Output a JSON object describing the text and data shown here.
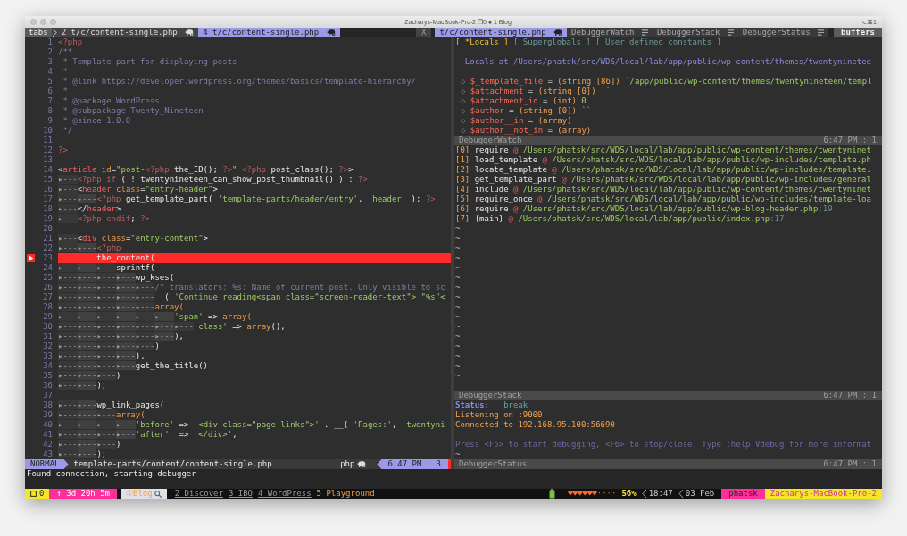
{
  "window": {
    "title": "Zacharys-MacBook-Pro-2 ❐0 ● 1 Blog",
    "shortcut": "⌥⌘1"
  },
  "tabline": {
    "label": "tabs",
    "buffers": [
      {
        "label": "2 t/c/content-single.php",
        "selected": false
      },
      {
        "label": "4 t/c/content-single.php",
        "selected": true
      }
    ],
    "close": "X",
    "windows": [
      {
        "label": "t/c/content-single.php",
        "selected": true,
        "kind": "file"
      },
      {
        "label": "DebuggerWatch",
        "selected": false,
        "kind": "debugger"
      },
      {
        "label": "DebuggerStack",
        "selected": false,
        "kind": "debugger"
      },
      {
        "label": "DebuggerStatus",
        "selected": false,
        "kind": "debugger"
      }
    ],
    "right_label": "buffers"
  },
  "editor": {
    "lines": [
      {
        "number": "1",
        "breakpoint": false,
        "tokens": [
          {
            "text": "<?php",
            "kind": "php"
          }
        ]
      },
      {
        "number": "2",
        "breakpoint": false,
        "tokens": [
          {
            "text": "/**",
            "kind": "cm"
          }
        ]
      },
      {
        "number": "3",
        "breakpoint": false,
        "tokens": [
          {
            "text": " * Template part for displaying posts",
            "kind": "cm"
          }
        ]
      },
      {
        "number": "4",
        "breakpoint": false,
        "tokens": [
          {
            "text": " *",
            "kind": "cm"
          }
        ]
      },
      {
        "number": "5",
        "breakpoint": false,
        "tokens": [
          {
            "text": " * @link https://developer.wordpress.org/themes/basics/template-hierarchy/",
            "kind": "cm"
          }
        ]
      },
      {
        "number": "6",
        "breakpoint": false,
        "tokens": [
          {
            "text": " *",
            "kind": "cm"
          }
        ]
      },
      {
        "number": "7",
        "breakpoint": false,
        "tokens": [
          {
            "text": " * @package WordPress",
            "kind": "cm"
          }
        ]
      },
      {
        "number": "8",
        "breakpoint": false,
        "tokens": [
          {
            "text": " * @subpackage Twenty_Nineteen",
            "kind": "cm"
          }
        ]
      },
      {
        "number": "9",
        "breakpoint": false,
        "tokens": [
          {
            "text": " * @since 1.0.0",
            "kind": "cm"
          }
        ]
      },
      {
        "number": "10",
        "breakpoint": false,
        "tokens": [
          {
            "text": " */",
            "kind": "cm"
          }
        ]
      },
      {
        "number": "11",
        "breakpoint": false
      },
      {
        "number": "12",
        "breakpoint": false,
        "tokens": [
          {
            "text": "?>",
            "kind": "php"
          }
        ]
      },
      {
        "number": "13",
        "breakpoint": false
      },
      {
        "number": "14",
        "breakpoint": false,
        "tokens": [
          {
            "text": "<",
            "kind": "pl"
          },
          {
            "text": "article",
            "kind": "tag"
          },
          {
            "text": " id",
            "kind": "kw"
          },
          {
            "text": "=",
            "kind": "pl"
          },
          {
            "text": "\"post-",
            "kind": "str"
          },
          {
            "text": "<?php",
            "kind": "php"
          },
          {
            "text": " the_ID(); ",
            "kind": "pl"
          },
          {
            "text": "?>",
            "kind": "php"
          },
          {
            "text": "\"",
            "kind": "str"
          },
          {
            "text": " <?php",
            "kind": "php"
          },
          {
            "text": " post_class(); ",
            "kind": "pl"
          },
          {
            "text": "?>",
            "kind": "php"
          },
          {
            "text": ">",
            "kind": "pl"
          }
        ]
      },
      {
        "number": "15",
        "breakpoint": false,
        "tokens": [
          {
            "text": "▸---",
            "kind": "tab"
          },
          {
            "text": "<?php if",
            "kind": "php"
          },
          {
            "text": " ( ! twentynineteen_can_show_post_thumbnail() ) : ",
            "kind": "pl"
          },
          {
            "text": "?>",
            "kind": "php"
          }
        ]
      },
      {
        "number": "16",
        "breakpoint": false,
        "tokens": [
          {
            "text": "▸---",
            "kind": "tab"
          },
          {
            "text": "<",
            "kind": "pl"
          },
          {
            "text": "header",
            "kind": "tag"
          },
          {
            "text": " class",
            "kind": "kw"
          },
          {
            "text": "=",
            "kind": "pl"
          },
          {
            "text": "\"entry-header\"",
            "kind": "str"
          },
          {
            "text": ">",
            "kind": "pl"
          }
        ]
      },
      {
        "number": "17",
        "breakpoint": false,
        "tokens": [
          {
            "text": "▸---",
            "kind": "tab"
          },
          {
            "text": "▸---",
            "kind": "tab"
          },
          {
            "text": "<?php",
            "kind": "php"
          },
          {
            "text": " get_template_part( ",
            "kind": "pl"
          },
          {
            "text": "'template-parts/header/entry'",
            "kind": "str"
          },
          {
            "text": ", ",
            "kind": "pl"
          },
          {
            "text": "'header'",
            "kind": "str"
          },
          {
            "text": " ); ",
            "kind": "pl"
          },
          {
            "text": "?>",
            "kind": "php"
          }
        ]
      },
      {
        "number": "18",
        "breakpoint": false,
        "tokens": [
          {
            "text": "▸---",
            "kind": "tab"
          },
          {
            "text": "</",
            "kind": "pl"
          },
          {
            "text": "header",
            "kind": "tag"
          },
          {
            "text": ">",
            "kind": "pl"
          }
        ]
      },
      {
        "number": "19",
        "breakpoint": false,
        "tokens": [
          {
            "text": "▸---",
            "kind": "tab"
          },
          {
            "text": "<?php endif",
            "kind": "php"
          },
          {
            "text": "; ",
            "kind": "pl"
          },
          {
            "text": "?>",
            "kind": "php"
          }
        ]
      },
      {
        "number": "20",
        "breakpoint": false
      },
      {
        "number": "21",
        "breakpoint": false,
        "tokens": [
          {
            "text": "▸---",
            "kind": "tab"
          },
          {
            "text": "<",
            "kind": "pl"
          },
          {
            "text": "div",
            "kind": "tag"
          },
          {
            "text": " class",
            "kind": "kw"
          },
          {
            "text": "=",
            "kind": "pl"
          },
          {
            "text": "\"entry-content\"",
            "kind": "str"
          },
          {
            "text": ">",
            "kind": "pl"
          }
        ]
      },
      {
        "number": "22",
        "breakpoint": false,
        "tokens": [
          {
            "text": "▸---",
            "kind": "tab"
          },
          {
            "text": "▸---",
            "kind": "tab"
          },
          {
            "text": "<?php",
            "kind": "php"
          }
        ]
      },
      {
        "number": "23",
        "breakpoint": true,
        "tokens": [
          {
            "text": "        the_content(",
            "kind": "pl"
          }
        ]
      },
      {
        "number": "24",
        "breakpoint": false,
        "tokens": [
          {
            "text": "▸---",
            "kind": "tab"
          },
          {
            "text": "▸---",
            "kind": "tab"
          },
          {
            "text": "▸---",
            "kind": "tab"
          },
          {
            "text": "sprintf(",
            "kind": "pl"
          }
        ]
      },
      {
        "number": "25",
        "breakpoint": false,
        "tokens": [
          {
            "text": "▸---",
            "kind": "tab"
          },
          {
            "text": "▸---",
            "kind": "tab"
          },
          {
            "text": "▸---",
            "kind": "tab"
          },
          {
            "text": "▸---",
            "kind": "tab"
          },
          {
            "text": "wp_kses(",
            "kind": "pl"
          }
        ]
      },
      {
        "number": "26",
        "breakpoint": false,
        "tokens": [
          {
            "text": "▸---",
            "kind": "tab"
          },
          {
            "text": "▸---",
            "kind": "tab"
          },
          {
            "text": "▸---",
            "kind": "tab"
          },
          {
            "text": "▸---",
            "kind": "tab"
          },
          {
            "text": "▸---",
            "kind": "tab"
          },
          {
            "text": "/* translators: %s: Name of current post. Only visible to sc",
            "kind": "cm"
          }
        ]
      },
      {
        "number": "27",
        "breakpoint": false,
        "tokens": [
          {
            "text": "▸---",
            "kind": "tab"
          },
          {
            "text": "▸---",
            "kind": "tab"
          },
          {
            "text": "▸---",
            "kind": "tab"
          },
          {
            "text": "▸---",
            "kind": "tab"
          },
          {
            "text": "▸---",
            "kind": "tab"
          },
          {
            "text": "__( ",
            "kind": "pl"
          },
          {
            "text": "'Continue reading<span class=\"screen-reader-text\"> \"%s\"<",
            "kind": "str"
          }
        ]
      },
      {
        "number": "28",
        "breakpoint": false,
        "tokens": [
          {
            "text": "▸---",
            "kind": "tab"
          },
          {
            "text": "▸---",
            "kind": "tab"
          },
          {
            "text": "▸---",
            "kind": "tab"
          },
          {
            "text": "▸---",
            "kind": "tab"
          },
          {
            "text": "▸---",
            "kind": "tab"
          },
          {
            "text": "array(",
            "kind": "kw"
          }
        ]
      },
      {
        "number": "29",
        "breakpoint": false,
        "tokens": [
          {
            "text": "▸---",
            "kind": "tab"
          },
          {
            "text": "▸---",
            "kind": "tab"
          },
          {
            "text": "▸---",
            "kind": "tab"
          },
          {
            "text": "▸---",
            "kind": "tab"
          },
          {
            "text": "▸---",
            "kind": "tab"
          },
          {
            "text": "▸---",
            "kind": "tab"
          },
          {
            "text": "'span'",
            "kind": "str"
          },
          {
            "text": " => ",
            "kind": "pl"
          },
          {
            "text": "array(",
            "kind": "kw"
          }
        ]
      },
      {
        "number": "30",
        "breakpoint": false,
        "tokens": [
          {
            "text": "▸---",
            "kind": "tab"
          },
          {
            "text": "▸---",
            "kind": "tab"
          },
          {
            "text": "▸---",
            "kind": "tab"
          },
          {
            "text": "▸---",
            "kind": "tab"
          },
          {
            "text": "▸---",
            "kind": "tab"
          },
          {
            "text": "▸---",
            "kind": "tab"
          },
          {
            "text": "▸---",
            "kind": "tab"
          },
          {
            "text": "'class'",
            "kind": "str"
          },
          {
            "text": " => ",
            "kind": "pl"
          },
          {
            "text": "array",
            "kind": "kw"
          },
          {
            "text": "(),",
            "kind": "pl"
          }
        ]
      },
      {
        "number": "31",
        "breakpoint": false,
        "tokens": [
          {
            "text": "▸---",
            "kind": "tab"
          },
          {
            "text": "▸---",
            "kind": "tab"
          },
          {
            "text": "▸---",
            "kind": "tab"
          },
          {
            "text": "▸---",
            "kind": "tab"
          },
          {
            "text": "▸---",
            "kind": "tab"
          },
          {
            "text": "▸---",
            "kind": "tab"
          },
          {
            "text": "),",
            "kind": "pl"
          }
        ]
      },
      {
        "number": "32",
        "breakpoint": false,
        "tokens": [
          {
            "text": "▸---",
            "kind": "tab"
          },
          {
            "text": "▸---",
            "kind": "tab"
          },
          {
            "text": "▸---",
            "kind": "tab"
          },
          {
            "text": "▸---",
            "kind": "tab"
          },
          {
            "text": "▸---",
            "kind": "tab"
          },
          {
            "text": ")",
            "kind": "pl"
          }
        ]
      },
      {
        "number": "33",
        "breakpoint": false,
        "tokens": [
          {
            "text": "▸---",
            "kind": "tab"
          },
          {
            "text": "▸---",
            "kind": "tab"
          },
          {
            "text": "▸---",
            "kind": "tab"
          },
          {
            "text": "▸---",
            "kind": "tab"
          },
          {
            "text": "),",
            "kind": "pl"
          }
        ]
      },
      {
        "number": "34",
        "breakpoint": false,
        "tokens": [
          {
            "text": "▸---",
            "kind": "tab"
          },
          {
            "text": "▸---",
            "kind": "tab"
          },
          {
            "text": "▸---",
            "kind": "tab"
          },
          {
            "text": "▸---",
            "kind": "tab"
          },
          {
            "text": "get_the_title()",
            "kind": "pl"
          }
        ]
      },
      {
        "number": "35",
        "breakpoint": false,
        "tokens": [
          {
            "text": "▸---",
            "kind": "tab"
          },
          {
            "text": "▸---",
            "kind": "tab"
          },
          {
            "text": "▸---",
            "kind": "tab"
          },
          {
            "text": ")",
            "kind": "pl"
          }
        ]
      },
      {
        "number": "36",
        "breakpoint": false,
        "tokens": [
          {
            "text": "▸---",
            "kind": "tab"
          },
          {
            "text": "▸---",
            "kind": "tab"
          },
          {
            "text": ");",
            "kind": "pl"
          }
        ]
      },
      {
        "number": "37",
        "breakpoint": false
      },
      {
        "number": "38",
        "breakpoint": false,
        "tokens": [
          {
            "text": "▸---",
            "kind": "tab"
          },
          {
            "text": "▸---",
            "kind": "tab"
          },
          {
            "text": "wp_link_pages(",
            "kind": "pl"
          }
        ]
      },
      {
        "number": "39",
        "breakpoint": false,
        "tokens": [
          {
            "text": "▸---",
            "kind": "tab"
          },
          {
            "text": "▸---",
            "kind": "tab"
          },
          {
            "text": "▸---",
            "kind": "tab"
          },
          {
            "text": "array(",
            "kind": "kw"
          }
        ]
      },
      {
        "number": "40",
        "breakpoint": false,
        "tokens": [
          {
            "text": "▸---",
            "kind": "tab"
          },
          {
            "text": "▸---",
            "kind": "tab"
          },
          {
            "text": "▸---",
            "kind": "tab"
          },
          {
            "text": "▸---",
            "kind": "tab"
          },
          {
            "text": "'before'",
            "kind": "str"
          },
          {
            "text": " => ",
            "kind": "pl"
          },
          {
            "text": "'<div class=\"page-links\">'",
            "kind": "str"
          },
          {
            "text": " . __( ",
            "kind": "pl"
          },
          {
            "text": "'Pages:'",
            "kind": "str"
          },
          {
            "text": ", ",
            "kind": "pl"
          },
          {
            "text": "'twentyni",
            "kind": "str"
          }
        ]
      },
      {
        "number": "41",
        "breakpoint": false,
        "tokens": [
          {
            "text": "▸---",
            "kind": "tab"
          },
          {
            "text": "▸---",
            "kind": "tab"
          },
          {
            "text": "▸---",
            "kind": "tab"
          },
          {
            "text": "▸---",
            "kind": "tab"
          },
          {
            "text": "'after'",
            "kind": "str"
          },
          {
            "text": "  => ",
            "kind": "pl"
          },
          {
            "text": "'</div>'",
            "kind": "str"
          },
          {
            "text": ",",
            "kind": "pl"
          }
        ]
      },
      {
        "number": "42",
        "breakpoint": false,
        "tokens": [
          {
            "text": "▸---",
            "kind": "tab"
          },
          {
            "text": "▸---",
            "kind": "tab"
          },
          {
            "text": "▸---",
            "kind": "tab"
          },
          {
            "text": ")",
            "kind": "pl"
          }
        ]
      },
      {
        "number": "43",
        "breakpoint": false,
        "tokens": [
          {
            "text": "▸---",
            "kind": "tab"
          },
          {
            "text": "▸---",
            "kind": "tab"
          },
          {
            "text": ");",
            "kind": "pl"
          }
        ]
      }
    ],
    "statusline": {
      "mode": "NORMAL",
      "file": "template-parts/content/content-single.php",
      "filetype": "php",
      "position": "6:47 PM : 3"
    }
  },
  "debugger": {
    "watch": {
      "tabs": [
        {
          "label": "[ *Locals ]",
          "selected": true
        },
        {
          "label": "[ Superglobals ]",
          "selected": false
        },
        {
          "label": "[ User defined constants ]",
          "selected": false
        }
      ],
      "heading": "- Locals at /Users/phatsk/src/WDS/local/lab/app/public/wp-content/themes/twentyninetee",
      "variables": [
        {
          "marker": "◇",
          "name": "$_template_file",
          "op": "=",
          "type": "(string [86])",
          "value": "`/app/public/wp-content/themes/twentynineteen/templ"
        },
        {
          "marker": "◇",
          "name": "$attachment",
          "op": "=",
          "type": "(string [0])",
          "value": "``"
        },
        {
          "marker": "◇",
          "name": "$attachment_id",
          "op": "=",
          "type": "(int)",
          "value": "0"
        },
        {
          "marker": "◇",
          "name": "$author",
          "op": "=",
          "type": "(string [0])",
          "value": "``"
        },
        {
          "marker": "◇",
          "name": "$author__in",
          "op": "=",
          "type": "(array)"
        },
        {
          "marker": "◇",
          "name": "$author__not_in",
          "op": "=",
          "type": "(array)"
        }
      ],
      "statusline": {
        "name": "DebuggerWatch",
        "position": "6:47 PM : 1"
      }
    },
    "stack": {
      "frames": [
        {
          "index": "[0]",
          "function": "require",
          "at": "@",
          "path": "/Users/phatsk/src/WDS/local/lab/app/public/wp-content/themes/twentyninet"
        },
        {
          "index": "[1]",
          "function": "load_template",
          "at": "@",
          "path": "/Users/phatsk/src/WDS/local/lab/app/public/wp-includes/template.ph"
        },
        {
          "index": "[2]",
          "function": "locate_template",
          "at": "@",
          "path": "/Users/phatsk/src/WDS/local/lab/app/public/wp-includes/template."
        },
        {
          "index": "[3]",
          "function": "get_template_part",
          "at": "@",
          "path": "/Users/phatsk/src/WDS/local/lab/app/public/wp-includes/general"
        },
        {
          "index": "[4]",
          "function": "include",
          "at": "@",
          "path": "/Users/phatsk/src/WDS/local/lab/app/public/wp-content/themes/twentyninet"
        },
        {
          "index": "[5]",
          "function": "require_once",
          "at": "@",
          "path": "/Users/phatsk/src/WDS/local/lab/app/public/wp-includes/template-loa"
        },
        {
          "index": "[6]",
          "function": "require",
          "at": "@",
          "path": "/Users/phatsk/src/WDS/local/lab/app/public/wp-blog-header.php",
          "line": ":19"
        },
        {
          "index": "[7]",
          "function": "{main}",
          "at": "@",
          "path": "/Users/phatsk/src/WDS/local/lab/app/public/index.php",
          "line": ":17"
        }
      ],
      "filler": [
        "~",
        "~",
        "~",
        "~",
        "~",
        "~",
        "~",
        "~",
        "~",
        "~",
        "~",
        "~",
        "~",
        "~",
        "~",
        "~"
      ],
      "statusline": {
        "name": "DebuggerStack",
        "position": "6:47 PM : 1"
      }
    },
    "status": {
      "label": "Status:",
      "state": "break",
      "lines": [
        "Listening on :9000",
        "Connected to 192.168.95.100:56690"
      ],
      "hint": "Press <F5> to start debugging, <F6> to stop/close. Type :help Vdebug for more informat",
      "filler": [
        "~"
      ],
      "statusline": {
        "name": "DebuggerStatus",
        "position": "6:47 PM : 1"
      }
    }
  },
  "message": "Found connection, starting debugger",
  "tmux": {
    "session": "0",
    "uptime": "↑ 3d 20h 5m",
    "windows": [
      {
        "label": "①Blog",
        "kind": "current"
      },
      {
        "label": "2 Discover",
        "kind": "activity"
      },
      {
        "label": "3 IBO",
        "kind": "activity"
      },
      {
        "label": "4 WordPress",
        "kind": "activity"
      },
      {
        "label": "5 Playground",
        "kind": "last"
      }
    ],
    "hearts": "♥♥♥♥♥♥····",
    "battery": "56%",
    "time": "18:47",
    "date": "03 Feb",
    "user": "phatsk",
    "host": "Zacharys-MacBook-Pro-2"
  }
}
